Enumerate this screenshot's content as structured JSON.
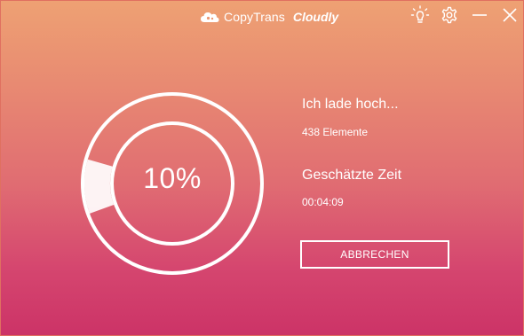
{
  "app": {
    "name_regular": "CopyTrans",
    "name_bold": "Cloudly",
    "logo_icon": "cloud-logo-icon"
  },
  "titlebar": {
    "tips_icon": "lightbulb-icon",
    "settings_icon": "gear-icon",
    "minimize_icon": "minimize-icon",
    "close_icon": "close-icon"
  },
  "progress": {
    "percent_label": "10%",
    "value": 0.1
  },
  "status": {
    "title": "Ich lade hoch...",
    "count": "438 Elemente",
    "time_title": "Geschätzte Zeit",
    "time_value": "00:04:09"
  },
  "actions": {
    "cancel_label": "ABBRECHEN"
  },
  "colors": {
    "gradient_top": "#eea173",
    "gradient_bottom": "#cc3367",
    "foreground": "#ffffff"
  }
}
